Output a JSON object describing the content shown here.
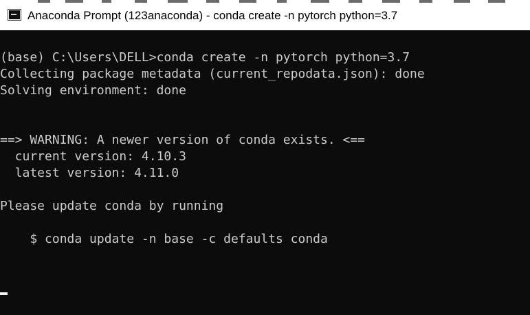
{
  "window": {
    "title": "Anaconda Prompt (123anaconda) - conda  create -n pytorch python=3.7",
    "icon": "terminal-icon"
  },
  "console": {
    "lines": [
      "(base) C:\\Users\\DELL>conda create -n pytorch python=3.7",
      "Collecting package metadata (current_repodata.json): done",
      "Solving environment: done",
      "",
      "",
      "==> WARNING: A newer version of conda exists. <==",
      "  current version: 4.10.3",
      "  latest version: 4.11.0",
      "",
      "Please update conda by running",
      "",
      "    $ conda update -n base -c defaults conda",
      "",
      "",
      ""
    ]
  },
  "colors": {
    "titlebar_background": "#ffffff",
    "title_text": "#000000",
    "console_background": "#0c0c0c",
    "console_text": "#cccccc",
    "cursor": "#f2f2f2"
  }
}
